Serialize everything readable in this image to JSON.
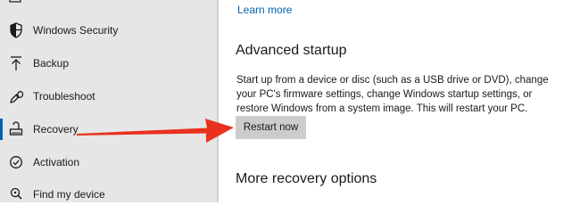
{
  "sidebar": {
    "items": [
      {
        "label": "Windows Security",
        "icon": "shield-icon"
      },
      {
        "label": "Backup",
        "icon": "backup-arrow-icon"
      },
      {
        "label": "Troubleshoot",
        "icon": "wrench-icon"
      },
      {
        "label": "Recovery",
        "icon": "recovery-icon",
        "selected": true
      },
      {
        "label": "Activation",
        "icon": "activation-check-icon"
      },
      {
        "label": "Find my device",
        "icon": "find-device-icon"
      }
    ]
  },
  "main": {
    "learn_more": "Learn more",
    "advanced_startup": {
      "heading": "Advanced startup",
      "description": "Start up from a device or disc (such as a USB drive or DVD), change your PC's firmware settings, change Windows startup settings, or restore Windows from a system image. This will restart your PC.",
      "button_label": "Restart now"
    },
    "more_recovery_heading": "More recovery options"
  },
  "colors": {
    "accent": "#0063b1",
    "annotation_arrow": "#e8321e",
    "sidebar_bg": "#e6e6e6",
    "button_bg": "#cccccc"
  }
}
